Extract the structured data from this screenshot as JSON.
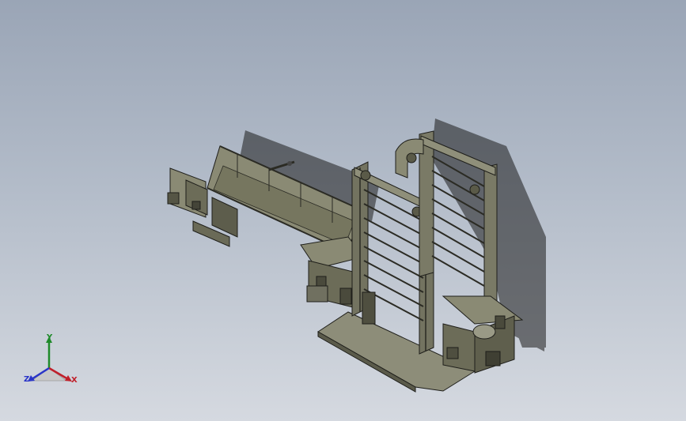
{
  "viewport": {
    "background_top": "#9aa5b6",
    "background_bottom": "#d5d9e0"
  },
  "model": {
    "shadow_color": "#2a2a2a",
    "frame_color": "#6e6e58",
    "frame_dark": "#3a3a30",
    "plate_color": "#7a7a66",
    "edge_color": "#1e1e1a"
  },
  "triad": {
    "x_label": "X",
    "y_label": "Y",
    "z_label": "Z",
    "x_color": "#c0202a",
    "y_color": "#1f8a2a",
    "z_color": "#2a35c8"
  }
}
